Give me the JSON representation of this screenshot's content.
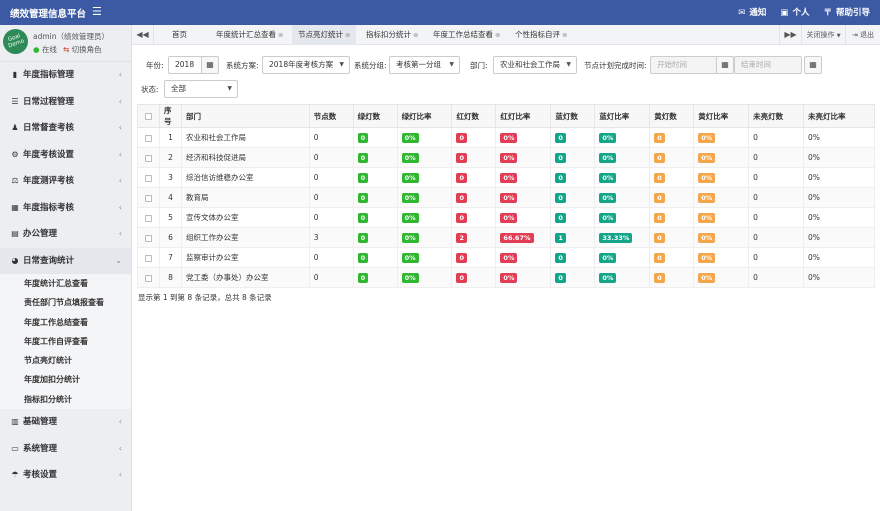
{
  "app": {
    "title": "绩效管理信息平台"
  },
  "topbar": {
    "items": [
      {
        "icon": "bell-icon",
        "glyph": "✉",
        "label": "通知"
      },
      {
        "icon": "user-icon",
        "glyph": "▣",
        "label": "个人"
      },
      {
        "icon": "help-icon",
        "glyph": "〒",
        "label": "帮助引导"
      }
    ]
  },
  "user": {
    "logo_text": "Goal Demo",
    "name": "admin（绩效管理员）",
    "status": "在线",
    "switch_role": "切换角色"
  },
  "sidebar": {
    "items_top": [
      {
        "icon": "chart-icon",
        "glyph": "▮",
        "label": "年度指标管理"
      },
      {
        "icon": "list-icon",
        "glyph": "☰",
        "label": "日常过程管理"
      },
      {
        "icon": "users-icon",
        "glyph": "♟",
        "label": "日常督查考核"
      },
      {
        "icon": "gear-icon",
        "glyph": "⚙",
        "label": "年度考核设置"
      },
      {
        "icon": "scale-icon",
        "glyph": "⚖",
        "label": "年度测评考核"
      },
      {
        "icon": "calendar-icon",
        "glyph": "▦",
        "label": "年度指标考核"
      },
      {
        "icon": "folder-icon",
        "glyph": "▤",
        "label": "办公管理"
      }
    ],
    "open_item": {
      "icon": "pie-icon",
      "glyph": "◕",
      "label": "日常查询统计"
    },
    "sub_items": [
      "年度统计汇总查看",
      "责任部门节点填报查看",
      "年度工作总结查看",
      "年度工作自评查看",
      "节点亮灯统计",
      "年度加扣分统计",
      "指标扣分统计"
    ],
    "items_bottom": [
      {
        "icon": "grid-icon",
        "glyph": "▥",
        "label": "基础管理"
      },
      {
        "icon": "monitor-icon",
        "glyph": "▭",
        "label": "系统管理"
      },
      {
        "icon": "umbrella-icon",
        "glyph": "☂",
        "label": "考核设置"
      }
    ]
  },
  "tabs": {
    "prev": "◀◀",
    "next": "▶▶",
    "items": [
      {
        "label": "首页",
        "closable": false
      },
      {
        "label": "年度统计汇总查看",
        "closable": true
      },
      {
        "label": "节点亮灯统计",
        "closable": true,
        "active": true
      },
      {
        "label": "指标扣分统计",
        "closable": true
      },
      {
        "label": "年度工作总结查看",
        "closable": true
      },
      {
        "label": "个性指标自评",
        "closable": true
      }
    ],
    "close_ops": "关闭操作",
    "logout": "退出"
  },
  "filters": {
    "year_label": "年份:",
    "year_value": "2018",
    "scheme_label": "系统方案:",
    "scheme_value": "2018年度考核方案",
    "group_label": "系统分组:",
    "group_value": "考核第一分组",
    "dept_label": "部门:",
    "dept_value": "农业和社会工作局",
    "time_label": "节点计划完成时间:",
    "start_placeholder": "开始时间",
    "end_placeholder": "结束时间",
    "status_label": "状态:",
    "status_value": "全部"
  },
  "table": {
    "headers": [
      "序号",
      "部门",
      "节点数",
      "绿灯数",
      "绿灯比率",
      "红灯数",
      "红灯比率",
      "蓝灯数",
      "蓝灯比率",
      "黄灯数",
      "黄灯比率",
      "未亮灯数",
      "未亮灯比率"
    ],
    "rows": [
      {
        "no": "1",
        "dept": "农业和社会工作局",
        "nodes": "0",
        "green": "0",
        "green_rate": "0%",
        "red": "0",
        "red_rate": "0%",
        "blue": "0",
        "blue_rate": "0%",
        "yellow": "0",
        "yellow_rate": "0%",
        "unlit": "0",
        "unlit_rate": "0%"
      },
      {
        "no": "2",
        "dept": "经济和科技促进局",
        "nodes": "0",
        "green": "0",
        "green_rate": "0%",
        "red": "0",
        "red_rate": "0%",
        "blue": "0",
        "blue_rate": "0%",
        "yellow": "0",
        "yellow_rate": "0%",
        "unlit": "0",
        "unlit_rate": "0%"
      },
      {
        "no": "3",
        "dept": "综治信访维稳办公室",
        "nodes": "0",
        "green": "0",
        "green_rate": "0%",
        "red": "0",
        "red_rate": "0%",
        "blue": "0",
        "blue_rate": "0%",
        "yellow": "0",
        "yellow_rate": "0%",
        "unlit": "0",
        "unlit_rate": "0%"
      },
      {
        "no": "4",
        "dept": "教育局",
        "nodes": "0",
        "green": "0",
        "green_rate": "0%",
        "red": "0",
        "red_rate": "0%",
        "blue": "0",
        "blue_rate": "0%",
        "yellow": "0",
        "yellow_rate": "0%",
        "unlit": "0",
        "unlit_rate": "0%"
      },
      {
        "no": "5",
        "dept": "宣传文体办公室",
        "nodes": "0",
        "green": "0",
        "green_rate": "0%",
        "red": "0",
        "red_rate": "0%",
        "blue": "0",
        "blue_rate": "0%",
        "yellow": "0",
        "yellow_rate": "0%",
        "unlit": "0",
        "unlit_rate": "0%"
      },
      {
        "no": "6",
        "dept": "组织工作办公室",
        "nodes": "3",
        "green": "0",
        "green_rate": "0%",
        "red": "2",
        "red_rate": "66.67%",
        "blue": "1",
        "blue_rate": "33.33%",
        "yellow": "0",
        "yellow_rate": "0%",
        "unlit": "0",
        "unlit_rate": "0%"
      },
      {
        "no": "7",
        "dept": "监察审计办公室",
        "nodes": "0",
        "green": "0",
        "green_rate": "0%",
        "red": "0",
        "red_rate": "0%",
        "blue": "0",
        "blue_rate": "0%",
        "yellow": "0",
        "yellow_rate": "0%",
        "unlit": "0",
        "unlit_rate": "0%"
      },
      {
        "no": "8",
        "dept": "党工委（办事处）办公室",
        "nodes": "0",
        "green": "0",
        "green_rate": "0%",
        "red": "0",
        "red_rate": "0%",
        "blue": "0",
        "blue_rate": "0%",
        "yellow": "0",
        "yellow_rate": "0%",
        "unlit": "0",
        "unlit_rate": "0%"
      }
    ]
  },
  "pagination": {
    "summary": "显示第 1 到第 8 条记录，总共 8 条记录"
  },
  "colors": {
    "header": "#3c5aa3",
    "green": "#2fb72f",
    "red": "#e33d55",
    "blue": "#13a589",
    "yellow": "#f4a64a"
  }
}
